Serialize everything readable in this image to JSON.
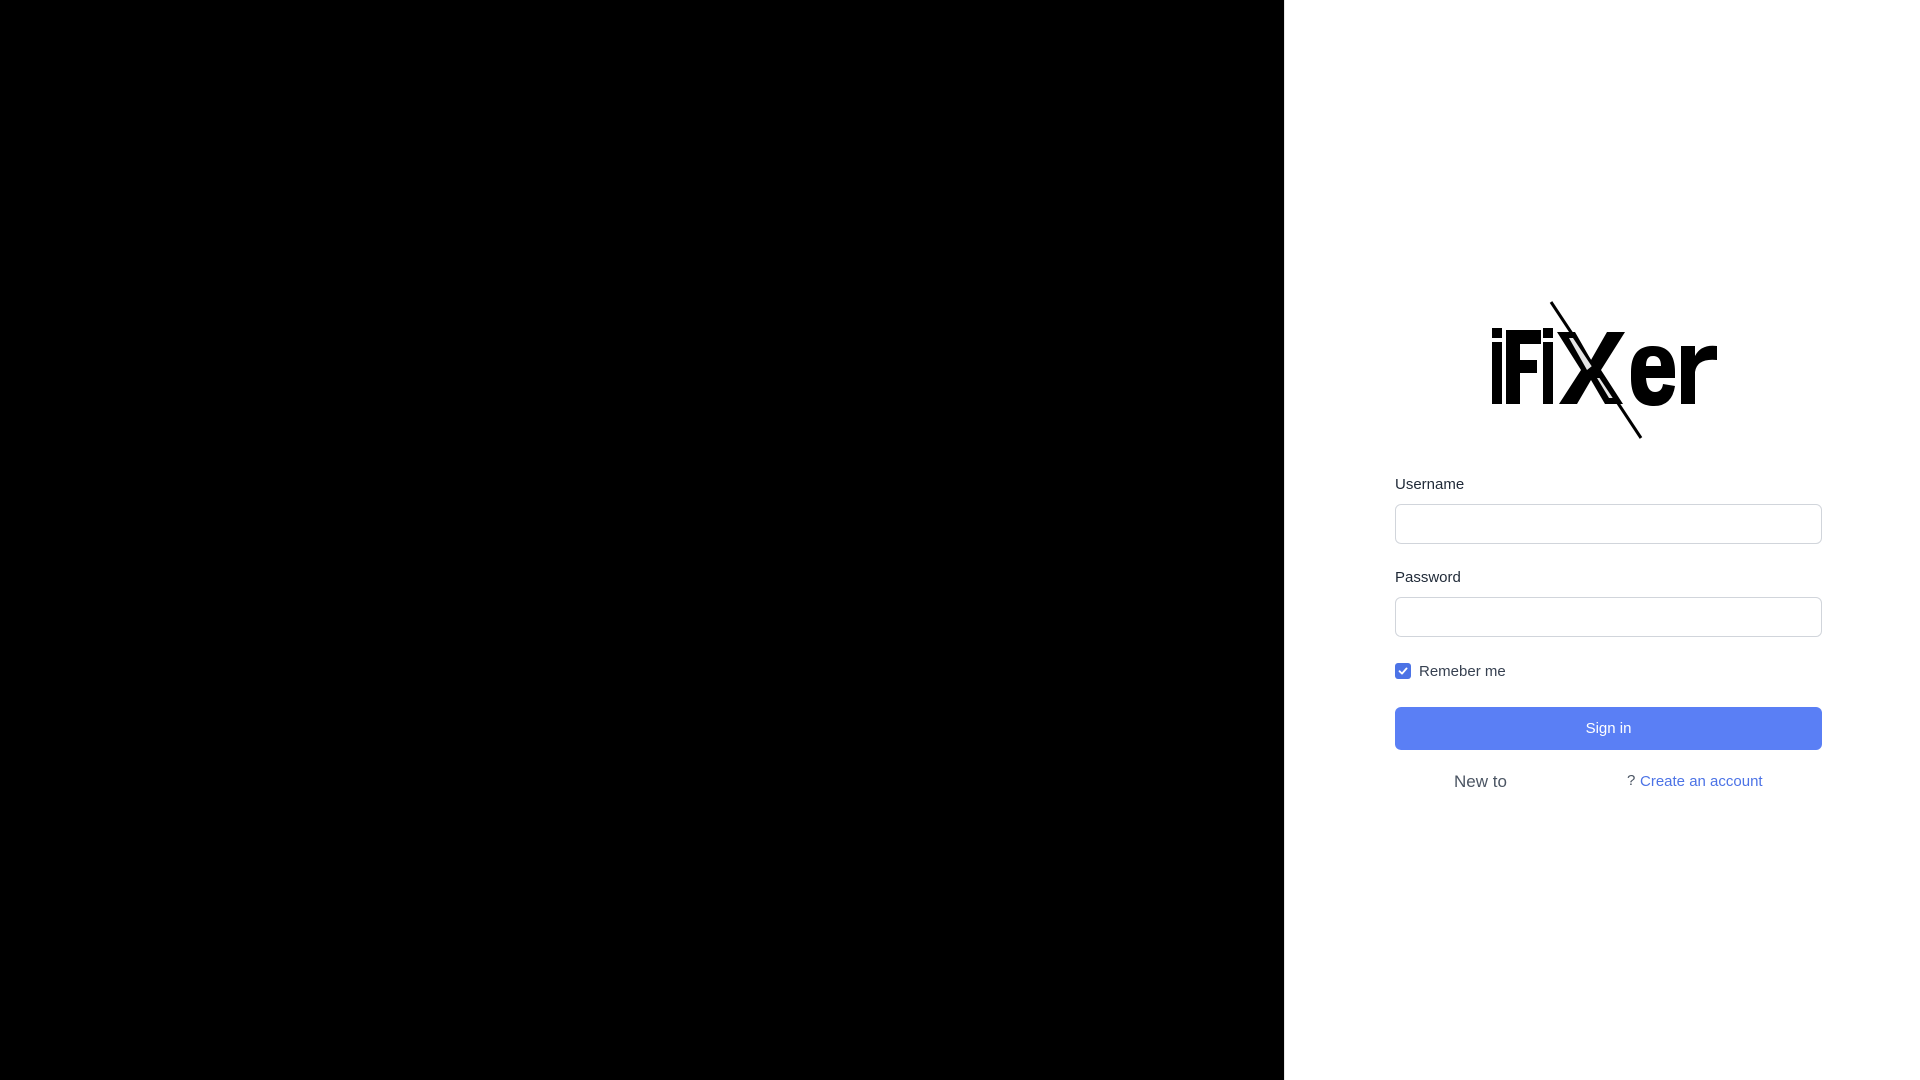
{
  "brand": {
    "logo_text": "iFiXer",
    "logo_icon": "ifixer-logo"
  },
  "login_form": {
    "username_label": "Username",
    "username_value": "",
    "password_label": "Password",
    "password_value": "",
    "remember_label": "Remeber me",
    "remember_checked": true,
    "signin_label": "Sign in"
  },
  "footer": {
    "new_to_text": "New to",
    "question_mark": "?",
    "create_account_label": "Create an account"
  },
  "colors": {
    "left_panel_bg": "#000000",
    "right_panel_bg": "#ffffff",
    "accent": "#5a7ff5",
    "link": "#4c73e6"
  }
}
